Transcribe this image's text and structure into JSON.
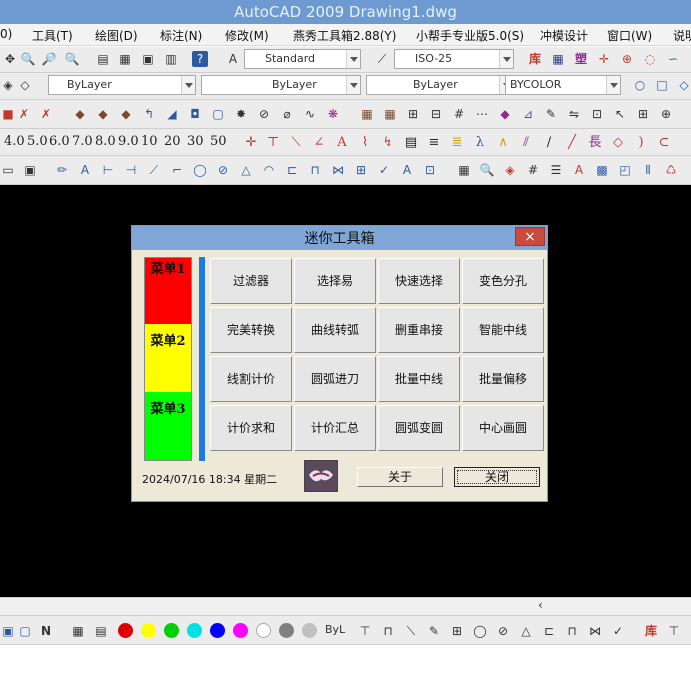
{
  "window": {
    "title": "AutoCAD 2009 Drawing1.dwg"
  },
  "menubar": {
    "items": [
      "0)",
      "工具(T)",
      "绘图(D)",
      "标注(N)",
      "修改(M)",
      "燕秀工具箱2.88(Y)",
      "小帮手专业版5.0(S)",
      "冲模设计",
      "窗口(W)",
      "说明"
    ]
  },
  "toolbar_styles": {
    "text_style": "Standard",
    "dim_style": "ISO-25"
  },
  "toolbar_layers": {
    "layer": "ByLayer",
    "linetype": "ByLayer",
    "lineweight": "ByLayer",
    "plotstyle": "BYCOLOR"
  },
  "toolbar_scale": {
    "values": [
      "4.0",
      "5.0",
      "6.0",
      "7.0",
      "8.0",
      "9.0",
      "10",
      "20",
      "30",
      "50"
    ]
  },
  "toolbar_extra": {
    "chars": [
      "長",
      "库",
      "塑"
    ]
  },
  "bottom_bar": {
    "label": "ByL",
    "colors": [
      "#e00000",
      "#ffff00",
      "#00d000",
      "#00e0e0",
      "#0000ff",
      "#ff00ff",
      "#ffffff",
      "#808080",
      "#c0c0c0"
    ],
    "char": "库"
  },
  "dialog": {
    "title": "迷你工具箱",
    "close_icon": "×",
    "side_menu": [
      {
        "label": "菜单1",
        "color": "#ff0000"
      },
      {
        "label": "菜单2",
        "color": "#ffff00"
      },
      {
        "label": "菜单3",
        "color": "#00ff00"
      }
    ],
    "buttons": [
      "过滤器",
      "选择易",
      "快速选择",
      "变色分孔",
      "完美转换",
      "曲线转弧",
      "删重串接",
      "智能中线",
      "线割计价",
      "圆弧进刀",
      "批量中线",
      "批量偏移",
      "计价求和",
      "计价汇总",
      "圆弧变圆",
      "中心画圆"
    ],
    "datetime": "2024/07/16 18:34 星期二",
    "about_label": "关于",
    "close_label": "关闭"
  }
}
